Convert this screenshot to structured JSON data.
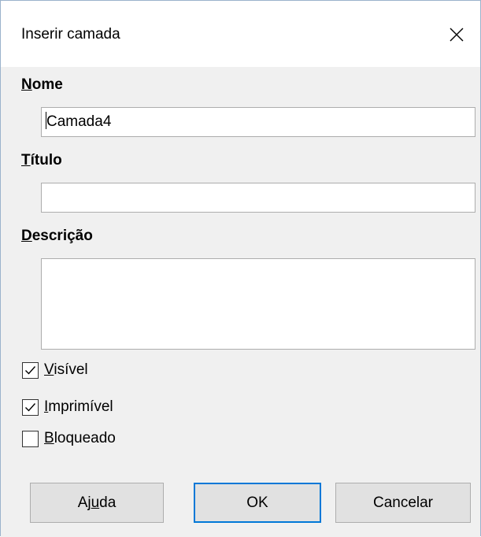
{
  "dialog": {
    "title": "Inserir camada"
  },
  "fields": {
    "name": {
      "label_mnemonic": "N",
      "label_rest": "ome",
      "value": "Camada4"
    },
    "title": {
      "label_mnemonic": "T",
      "label_rest": "ítulo",
      "value": ""
    },
    "description": {
      "label_mnemonic": "D",
      "label_rest": "escrição",
      "value": ""
    }
  },
  "options": {
    "visible": {
      "label_mnemonic": "V",
      "label_rest": "isível",
      "checked": true
    },
    "printable": {
      "label_mnemonic": "I",
      "label_rest": "mprimível",
      "checked": true
    },
    "locked": {
      "label_mnemonic": "B",
      "label_rest": "loqueado",
      "checked": false
    }
  },
  "buttons": {
    "help": {
      "label_pre": "Aj",
      "label_mnemonic": "u",
      "label_post": "da"
    },
    "ok": {
      "label": "OK"
    },
    "cancel": {
      "label": "Cancelar"
    }
  },
  "icons": {
    "close": "close-icon",
    "check": "checkmark-icon"
  },
  "colors": {
    "dialog_background": "#f0f0f0",
    "title_background": "#ffffff",
    "default_button_border": "#0078d7",
    "button_face": "#e1e1e1"
  }
}
